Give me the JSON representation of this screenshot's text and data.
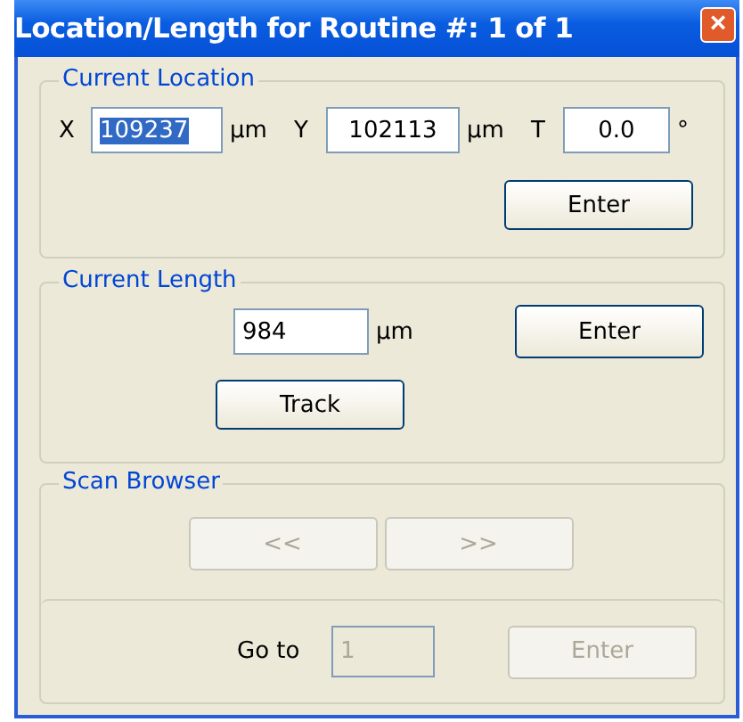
{
  "window": {
    "title": "Location/Length for Routine #: 1 of 1",
    "close": "×"
  },
  "current_location": {
    "title": "Current Location",
    "fields": [
      {
        "label": "X",
        "value": "109237",
        "unit": "µm",
        "text_selected": true
      },
      {
        "label": "Y",
        "value": "102113",
        "unit": "µm",
        "text_selected": false
      },
      {
        "label": "T",
        "value": "0.0",
        "unit": "°",
        "text_selected": false
      }
    ],
    "enter_button": {
      "label": "Enter",
      "disabled": false
    }
  },
  "current_length": {
    "title": "Current Length",
    "value": "984",
    "unit": "µm",
    "enter_button": {
      "label": "Enter",
      "disabled": false
    },
    "track_button": {
      "label": "Track",
      "disabled": false
    }
  },
  "scan_browser": {
    "title": "Scan Browser",
    "prev_button": {
      "label": "<<",
      "disabled": true
    },
    "next_button": {
      "label": ">>",
      "disabled": true
    },
    "goto_label": "Go to",
    "goto_value": "1",
    "goto_disabled": true,
    "enter_button": {
      "label": "Enter",
      "disabled": true
    }
  }
}
